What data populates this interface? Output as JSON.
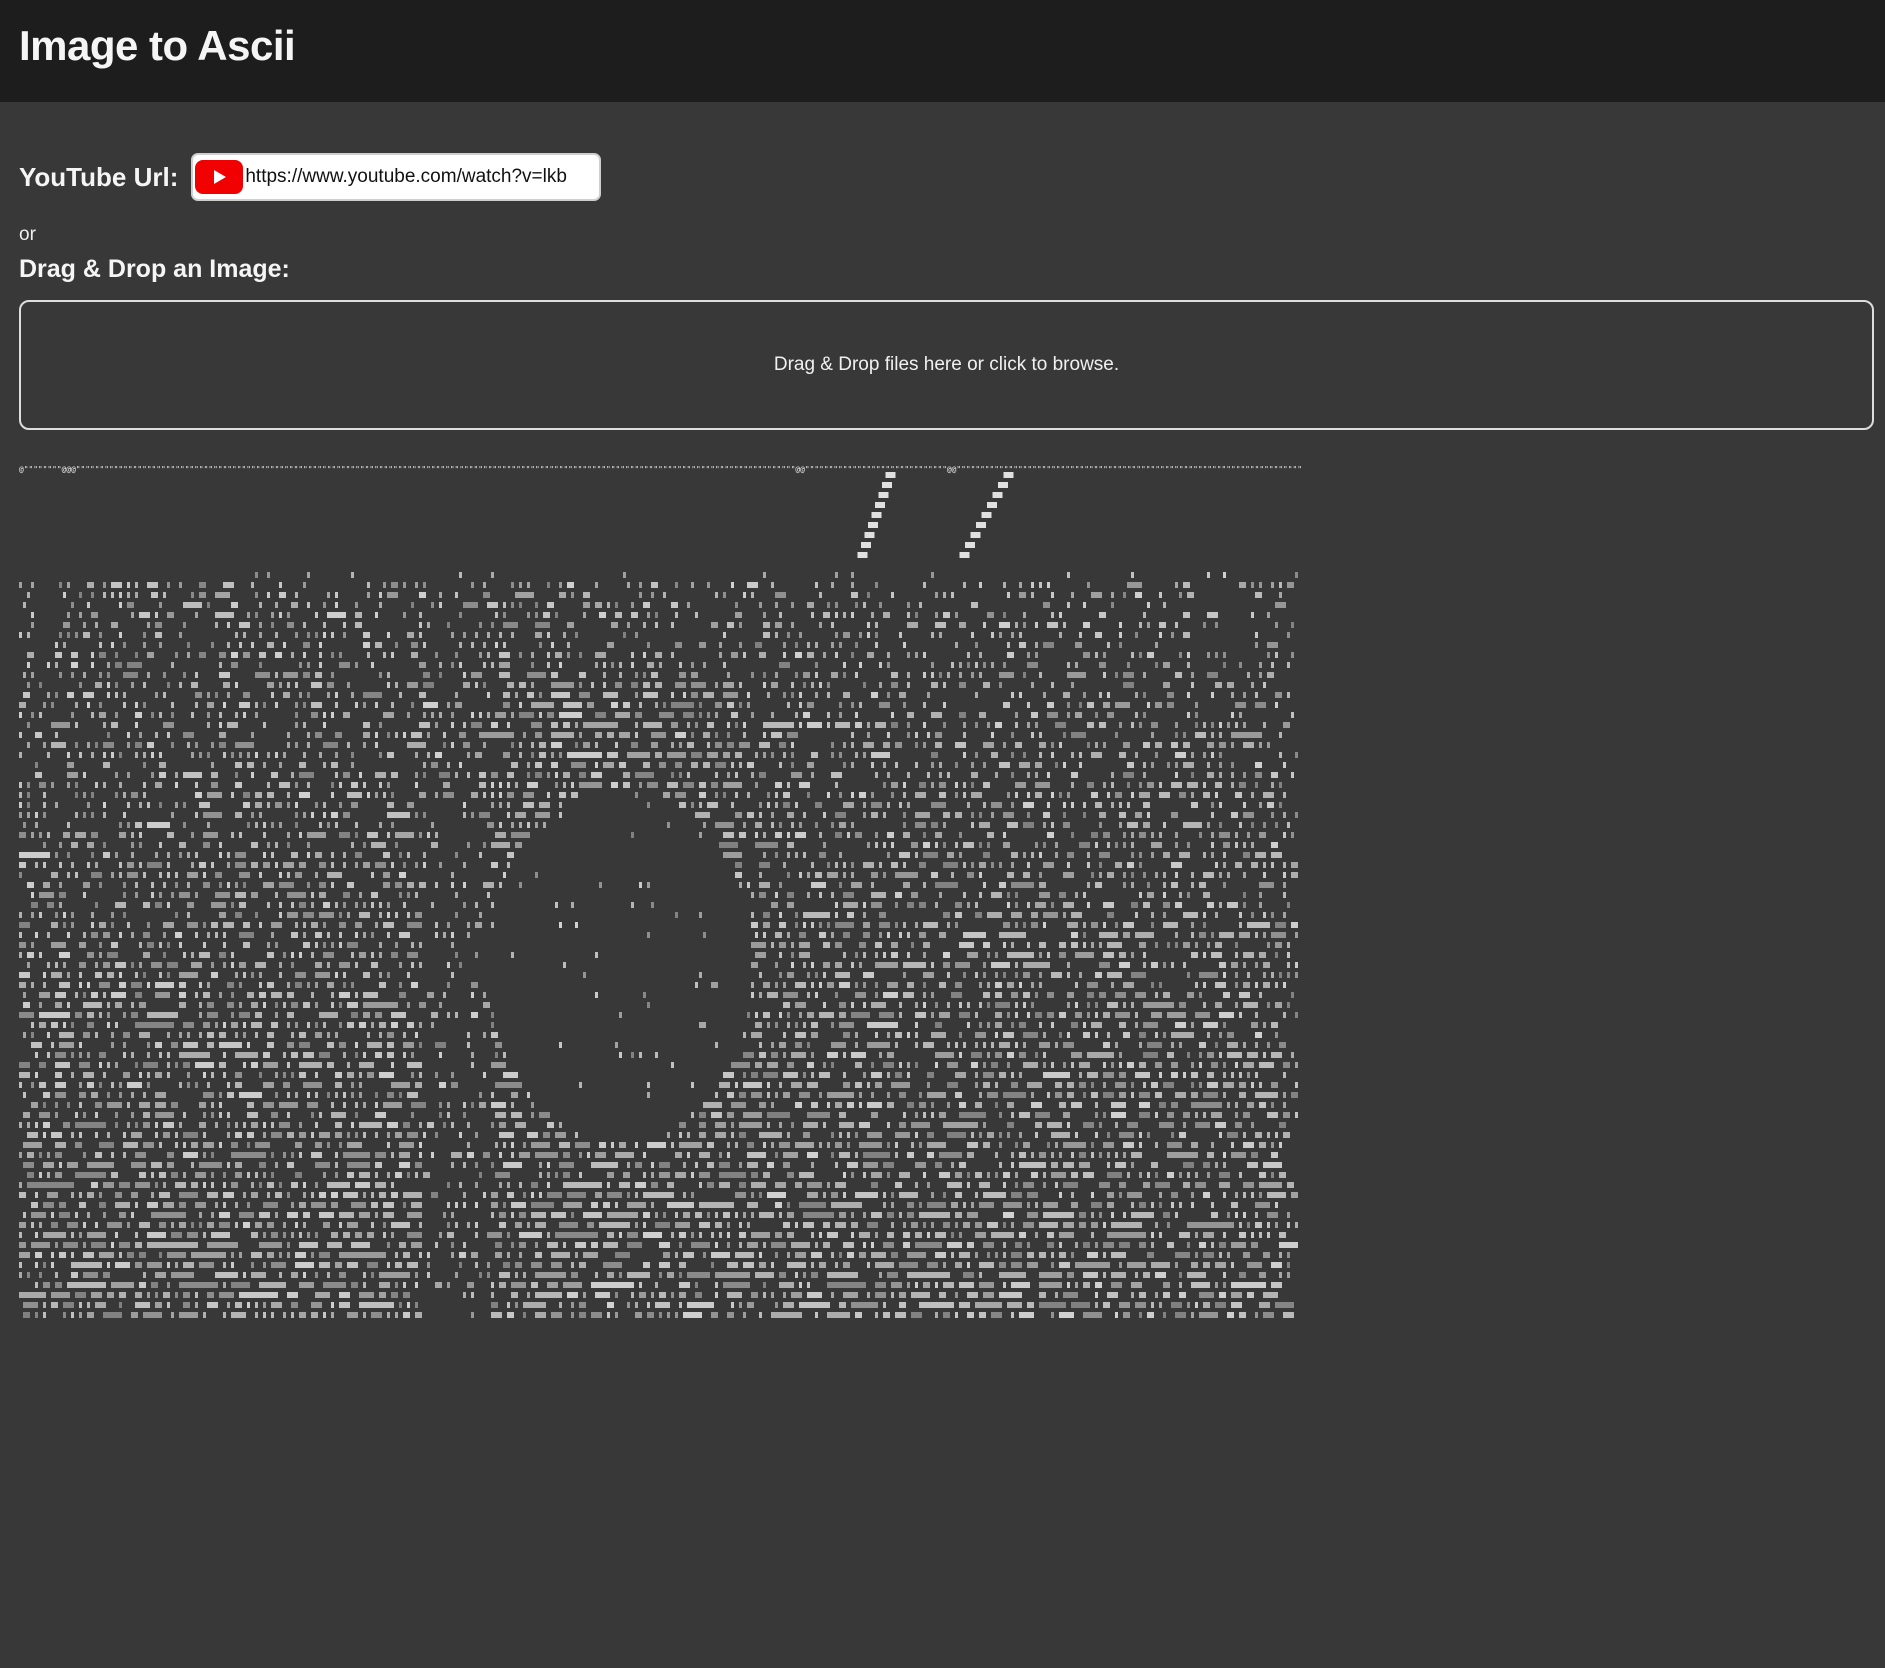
{
  "header": {
    "title": "Image to Ascii"
  },
  "youtube": {
    "label": "YouTube Url:",
    "value": "https://www.youtube.com/watch?v=lkb",
    "icon": "youtube-play-icon"
  },
  "or_text": "or",
  "dropzone": {
    "label": "Drag & Drop an Image:",
    "text": "Drag & Drop files here or click to browse."
  },
  "ascii_art": {
    "top_rule": "@\"\"\"\"\"\"\"\"@@@\"\"\"\"\"\"\"\"\"\"\"\"\"\"\"\"\"\"\"\"\"\"\"\"\"\"\"\"\"\"\"\"\"\"\"\"\"\"\"\"\"\"\"\"\"\"\"\"\"\"\"\"\"\"\"\"\"\"\"\"\"\"\"\"\"\"\"\"\"\"\"\"\"\"\"\"\"\"\"\"\"\"\"\"\"\"\"\"\"\"\"\"\"\"\"\"\"\"\"\"\"\"\"\"\"\"\"\"\"\"\"\"\"\"\"\"\"\"\"\"\"\"\"\"\"\"\"\"\"\"\"\"\"\"\"\"\"\"\"\"\"\"\"\"\"\"\"\"\"\"\"\"@@\"\"\"\"\"\"\"\"\"\"\"\"\"\"\"\"\"\"\"\"\"\"\"\"\"\"\"\"\"\"@@\"\"\"\"\"\"\"\"\"\"\"\"\"\"\"\"\"\"\"\"\"\"\"\"\"\"\"\"\"\"\"\"\"\"\"\"\"\"\"\"\"\"\"\"\"\"\"\"\"\"\"\"\"\"\"\"\"\"\"\"\"\"\"\"\"\"\"\"\"\"\"\"\""
  }
}
